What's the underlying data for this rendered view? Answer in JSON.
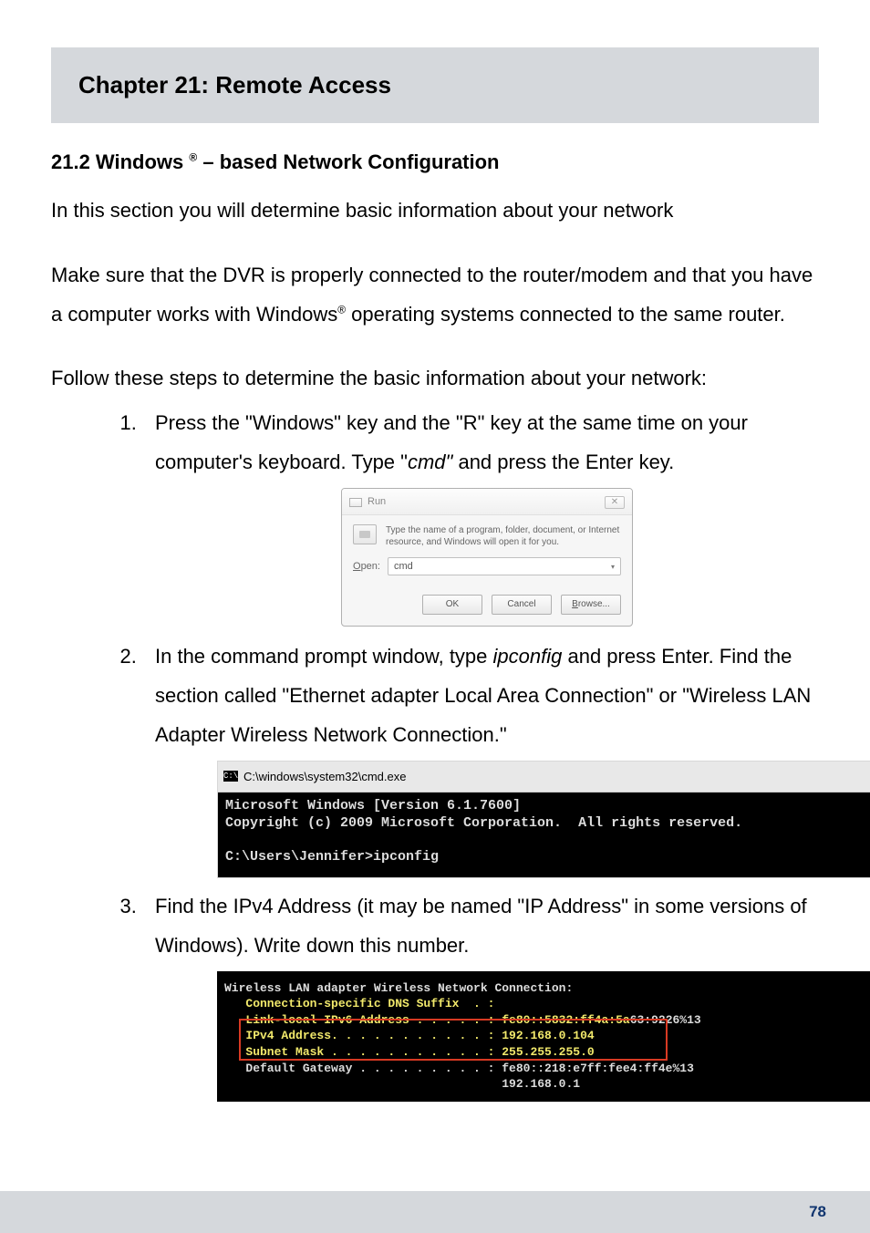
{
  "chapter": {
    "title": "Chapter 21: Remote Access"
  },
  "section": {
    "heading_prefix": "21.2 Windows ",
    "heading_suffix": " – based Network Configuration",
    "reg": "®"
  },
  "paragraphs": {
    "intro": "In this section you will determine basic information about your network",
    "para2_a": "Make sure that the DVR is properly connected to the router/modem and that you have a computer works with Windows",
    "para2_b": " operating systems connected to the same router.",
    "reg": "®",
    "followIntro": "Follow these steps to determine the basic information about your network:"
  },
  "steps": {
    "s1": {
      "text_a": "Press the \"Windows\" key and the \"R\" key at the same time on your computer's keyboard. Type \"",
      "cmd": "cmd\"",
      "text_b": " and press the Enter key."
    },
    "s2": {
      "text_a": "In the command prompt window, type ",
      "ipconfig": "ipconfig",
      "text_b": " and press Enter. Find the section called \"Ethernet adapter Local Area Connection\" or \"Wireless LAN Adapter Wireless Network Connection.\""
    },
    "s3": {
      "text": "Find the IPv4 Address (it may be named \"IP Address\" in some versions of Windows). Write down this number."
    }
  },
  "runDialog": {
    "title": "Run",
    "close": "✕",
    "description": "Type the name of a program, folder, document, or Internet resource, and Windows will open it for you.",
    "openLabel_pre": "O",
    "openLabel_rest": "pen:",
    "openValue": "cmd",
    "caret": "▾",
    "buttons": {
      "ok": "OK",
      "cancel": "Cancel",
      "browse_u": "B",
      "browse_rest": "rowse..."
    }
  },
  "cmd1": {
    "titleIcon": "C:\\",
    "titlePath": "C:\\windows\\system32\\cmd.exe",
    "line1": "Microsoft Windows [Version 6.1.7600]",
    "line2": "Copyright (c) 2009 Microsoft Corporation.  All rights reserved.",
    "blank": "",
    "line3": "C:\\Users\\Jennifer>ipconfig"
  },
  "cmd2": {
    "line1": "Wireless LAN adapter Wireless Network Connection:",
    "blank": "",
    "line2": "   Connection-specific DNS Suffix  . :",
    "line3a": "   Link-local IPv6 Address . . . . . : fe80::5832:ff4a:5a",
    "line3b": "63:9226%13",
    "line4": "   IPv4 Address. . . . . . . . . . . : 192.168.0.104",
    "line5": "   Subnet Mask . . . . . . . . . . . : 255.255.255.0",
    "line6": "   Default Gateway . . . . . . . . . : fe80::218:e7ff:fee4:ff4e%13",
    "line7": "                                       192.168.0.1"
  },
  "footer": {
    "pageNumber": "78"
  }
}
